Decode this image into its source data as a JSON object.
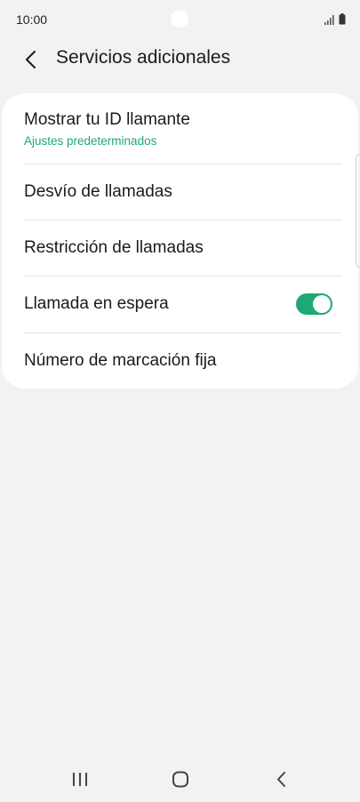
{
  "status_bar": {
    "time": "10:00",
    "icons": [
      "signal-icon",
      "battery-icon"
    ]
  },
  "header": {
    "back_icon": "chevron-left-icon",
    "title": "Servicios adicionales"
  },
  "settings": {
    "items": [
      {
        "label": "Mostrar tu ID llamante",
        "sublabel": "Ajustes predeterminados"
      },
      {
        "label": "Desvío de llamadas"
      },
      {
        "label": "Restricción de llamadas"
      },
      {
        "label": "Llamada en espera",
        "toggle_on": true
      },
      {
        "label": "Número de marcación fija"
      }
    ]
  },
  "nav_bar": {
    "icons": [
      "recent-apps-icon",
      "home-icon",
      "back-icon"
    ]
  },
  "colors": {
    "background": "#f2f2f2",
    "card": "#ffffff",
    "accent": "#1fa872",
    "text": "#1a1a1a",
    "divider": "#e3e3e3"
  }
}
